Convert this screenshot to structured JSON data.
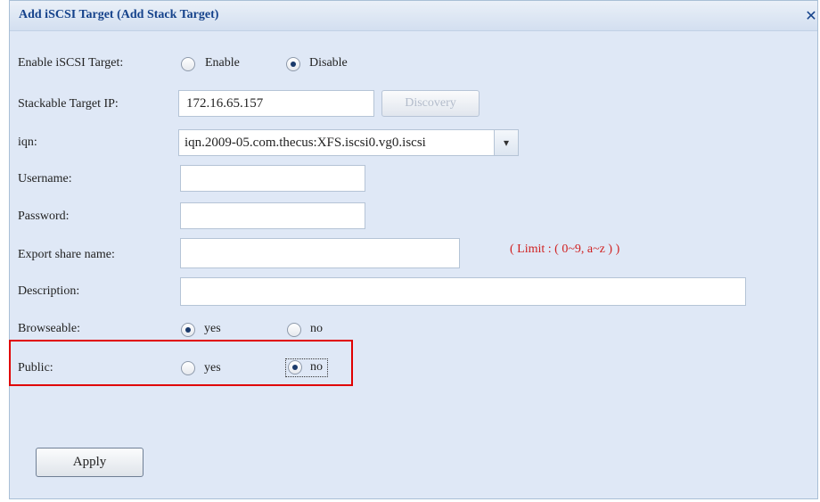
{
  "dialog": {
    "title": "Add iSCSI Target (Add Stack Target)",
    "close_glyph": "✕"
  },
  "form": {
    "enable": {
      "label": "Enable iSCSI Target:",
      "options": [
        "Enable",
        "Disable"
      ],
      "selected": "Disable"
    },
    "target_ip": {
      "label": "Stackable Target IP:",
      "value": "172.16.65.157",
      "discovery_label": "Discovery"
    },
    "iqn": {
      "label": "iqn:",
      "value": "iqn.2009-05.com.thecus:XFS.iscsi0.vg0.iscsi",
      "dropdown_glyph": "▾"
    },
    "username": {
      "label": "Username:",
      "value": ""
    },
    "password": {
      "label": "Password:",
      "value": ""
    },
    "export_share": {
      "label": "Export share name:",
      "value": "",
      "hint": "( Limit : ( 0~9, a~z ) )"
    },
    "description": {
      "label": "Description:",
      "value": ""
    },
    "browseable": {
      "label": "Browseable:",
      "options": [
        "yes",
        "no"
      ],
      "selected": "yes"
    },
    "public": {
      "label": "Public:",
      "options": [
        "yes",
        "no"
      ],
      "selected": "no"
    },
    "apply_label": "Apply"
  },
  "colors": {
    "title": "#15428b",
    "hint": "#d02020",
    "highlight": "#e00000",
    "panel": "#dfe8f6"
  }
}
